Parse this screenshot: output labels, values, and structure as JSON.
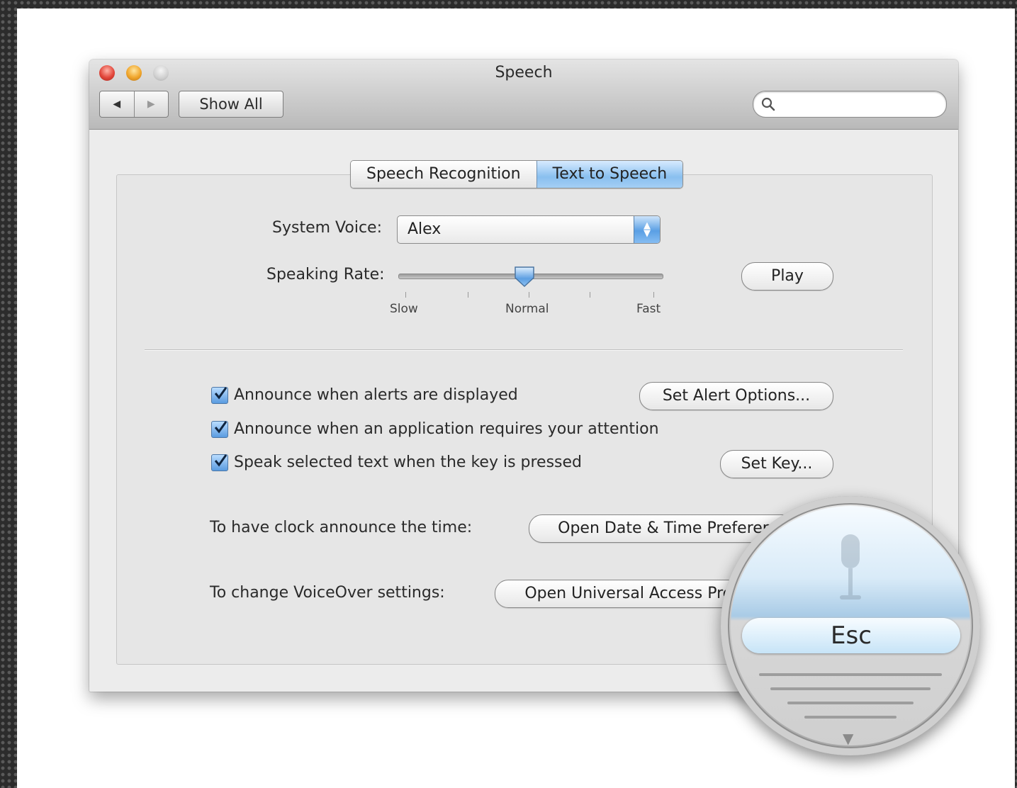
{
  "window": {
    "title": "Speech",
    "nav_back": "◀",
    "nav_forward": "▶",
    "show_all": "Show All",
    "search_placeholder": ""
  },
  "tabs": [
    {
      "label": "Speech Recognition",
      "active": false
    },
    {
      "label": "Text to Speech",
      "active": true
    }
  ],
  "voice": {
    "label": "System Voice:",
    "value": "Alex"
  },
  "rate": {
    "label": "Speaking Rate:",
    "slow": "Slow",
    "normal": "Normal",
    "fast": "Fast",
    "level": 0.5,
    "play": "Play"
  },
  "options": [
    {
      "label": "Announce when alerts are displayed",
      "checked": true,
      "button": "Set Alert Options..."
    },
    {
      "label": "Announce when an application requires your attention",
      "checked": true,
      "button": ""
    },
    {
      "label": "Speak selected text when the key is pressed",
      "checked": true,
      "button": "Set Key..."
    }
  ],
  "clock": {
    "label": "To have clock announce the time:",
    "button": "Open Date & Time Preferences"
  },
  "voiceover": {
    "label": "To change VoiceOver settings:",
    "button": "Open Universal Access Preferences"
  },
  "magnifier": {
    "key": "Esc"
  },
  "colors": {
    "accent": "#89bfef",
    "checkbox": "#5a9be0"
  }
}
